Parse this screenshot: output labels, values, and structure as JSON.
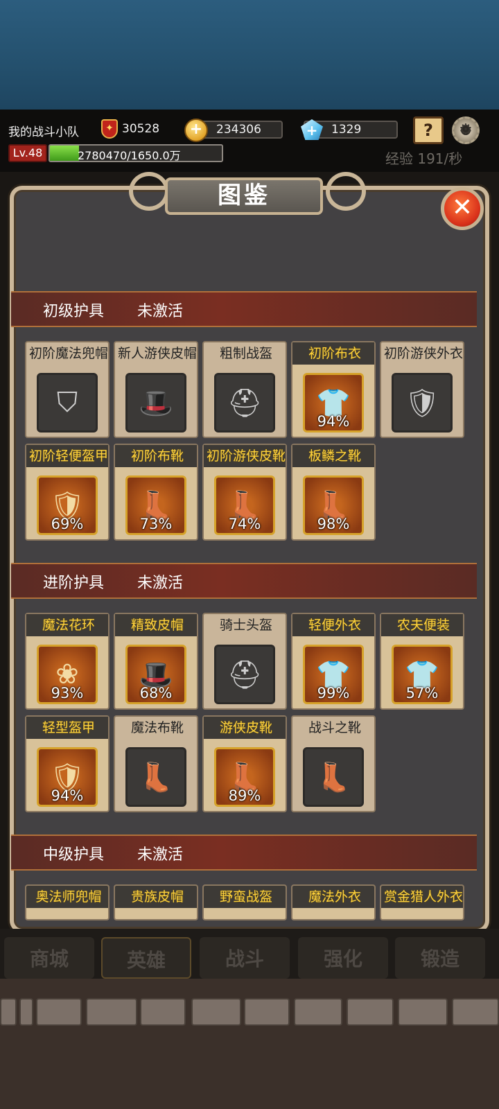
{
  "header": {
    "team_name": "我的战斗小队",
    "power": "30528",
    "gold": "234306",
    "gems": "1329",
    "level": "Lv.48",
    "exp": "2780470/1650.0万",
    "exp_ratio": 0.168,
    "exp_rate": "经验 191/秒",
    "guide_icon": "book-question-icon",
    "settings_icon": "gear-icon"
  },
  "dialog": {
    "title": "图鉴",
    "close": "✕"
  },
  "sections": [
    {
      "title": "初级护具",
      "status": "未激活",
      "items": [
        {
          "name": "初阶魔法兜帽",
          "pct": "",
          "icon": "wizard-hat-icon",
          "glyph": "⛉",
          "active": false
        },
        {
          "name": "新人游侠皮帽",
          "pct": "",
          "icon": "feather-hat-icon",
          "glyph": "🎩",
          "active": false
        },
        {
          "name": "粗制战盔",
          "pct": "",
          "icon": "helmet-icon",
          "glyph": "⛑",
          "active": false
        },
        {
          "name": "初阶布衣",
          "pct": "94%",
          "icon": "cloth-vest-icon",
          "glyph": "👕",
          "active": true
        },
        {
          "name": "初阶游侠外衣",
          "pct": "",
          "icon": "ranger-coat-icon",
          "glyph": "🛡",
          "active": false
        },
        {
          "name": "初阶轻便盔甲",
          "pct": "69%",
          "icon": "light-armor-icon",
          "glyph": "🛡",
          "active": true
        },
        {
          "name": "初阶布靴",
          "pct": "73%",
          "icon": "cloth-boots-icon",
          "glyph": "👢",
          "active": true
        },
        {
          "name": "初阶游侠皮靴",
          "pct": "74%",
          "icon": "ranger-boots-icon",
          "glyph": "👢",
          "active": true
        },
        {
          "name": "板鳞之靴",
          "pct": "98%",
          "icon": "plate-boots-icon",
          "glyph": "👢",
          "active": true
        }
      ]
    },
    {
      "title": "进阶护具",
      "status": "未激活",
      "items": [
        {
          "name": "魔法花环",
          "pct": "93%",
          "icon": "wreath-icon",
          "glyph": "❀",
          "active": true
        },
        {
          "name": "精致皮帽",
          "pct": "68%",
          "icon": "goggle-hat-icon",
          "glyph": "🎩",
          "active": true
        },
        {
          "name": "骑士头盔",
          "pct": "",
          "icon": "knight-helmet-icon",
          "glyph": "⛑",
          "active": false
        },
        {
          "name": "轻便外衣",
          "pct": "99%",
          "icon": "light-coat-icon",
          "glyph": "👕",
          "active": true
        },
        {
          "name": "农夫便装",
          "pct": "57%",
          "icon": "farmer-clothes-icon",
          "glyph": "👕",
          "active": true
        },
        {
          "name": "轻型盔甲",
          "pct": "94%",
          "icon": "light-armor-icon",
          "glyph": "🛡",
          "active": true
        },
        {
          "name": "魔法布靴",
          "pct": "",
          "icon": "magic-boots-icon",
          "glyph": "👢",
          "active": false
        },
        {
          "name": "游侠皮靴",
          "pct": "89%",
          "icon": "ranger-boots-icon",
          "glyph": "👢",
          "active": true
        },
        {
          "name": "战斗之靴",
          "pct": "",
          "icon": "battle-boots-icon",
          "glyph": "👢",
          "active": false
        }
      ]
    },
    {
      "title": "中级护具",
      "status": "未激活",
      "items": [
        {
          "name": "奥法师兜帽",
          "pct": "",
          "icon": "",
          "glyph": "",
          "active": true
        },
        {
          "name": "贵族皮帽",
          "pct": "",
          "icon": "",
          "glyph": "",
          "active": true
        },
        {
          "name": "野蛮战盔",
          "pct": "",
          "icon": "",
          "glyph": "",
          "active": true
        },
        {
          "name": "魔法外衣",
          "pct": "",
          "icon": "",
          "glyph": "",
          "active": true
        },
        {
          "name": "赏金猎人外衣",
          "pct": "",
          "icon": "",
          "glyph": "",
          "active": true
        }
      ]
    }
  ],
  "tabs": [
    "商城",
    "英雄",
    "战斗",
    "强化",
    "锻造"
  ],
  "active_tab": "英雄"
}
